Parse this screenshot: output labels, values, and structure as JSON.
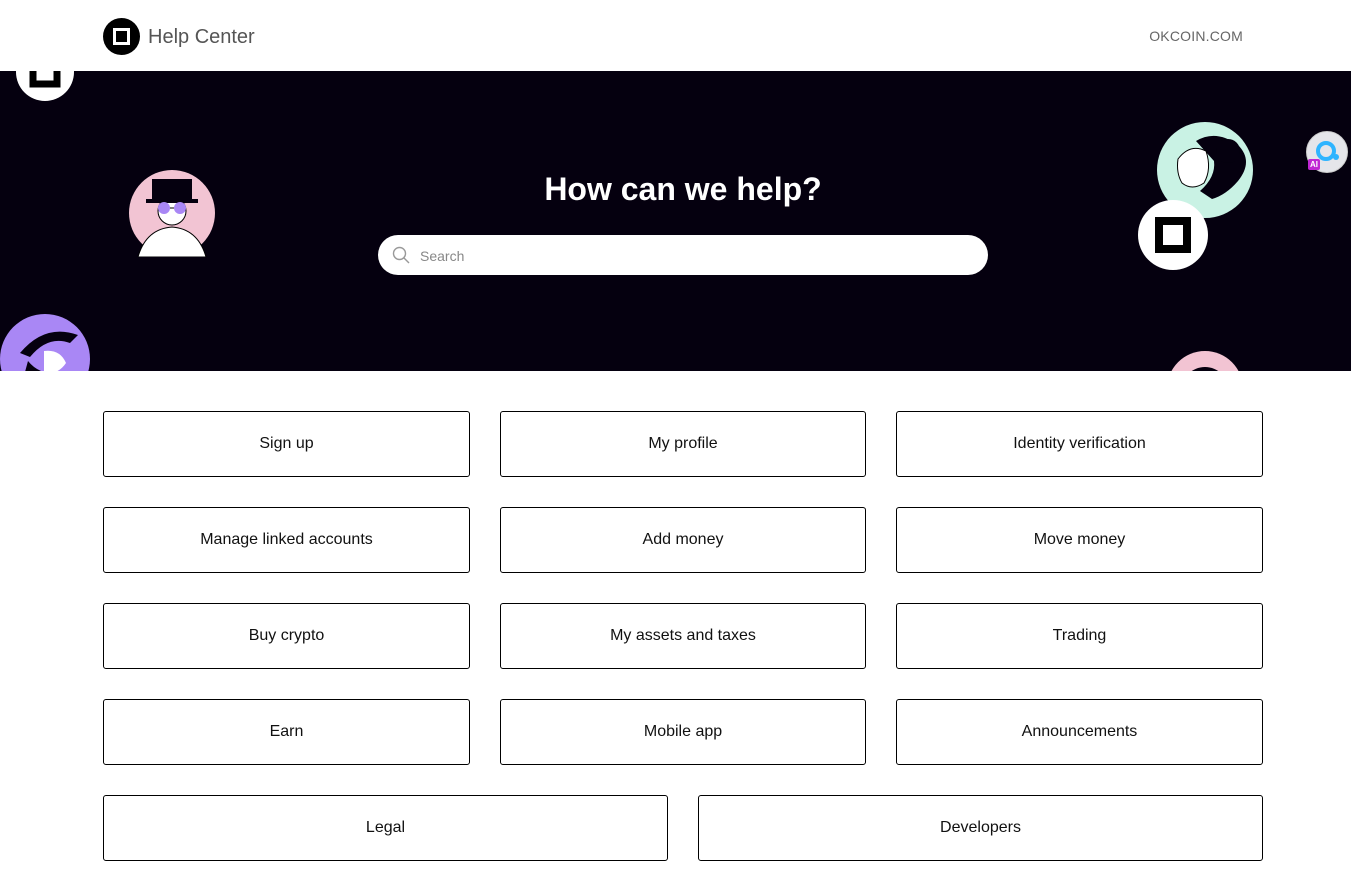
{
  "header": {
    "brand": "Help Center",
    "site_link": "OKCOIN.COM"
  },
  "hero": {
    "title": "How can we help?",
    "search_placeholder": "Search"
  },
  "widget": {
    "badge": "AI"
  },
  "categories": [
    "Sign up",
    "My profile",
    "Identity verification",
    "Manage linked accounts",
    "Add money",
    "Move money",
    "Buy crypto",
    "My assets and taxes",
    "Trading",
    "Earn",
    "Mobile app",
    "Announcements",
    "Legal",
    "Developers"
  ],
  "colors": {
    "hero_bg": "#05000f",
    "accent_pink": "#f2c4d3",
    "accent_mint": "#c9f2e4",
    "accent_purple": "#a987f5"
  }
}
